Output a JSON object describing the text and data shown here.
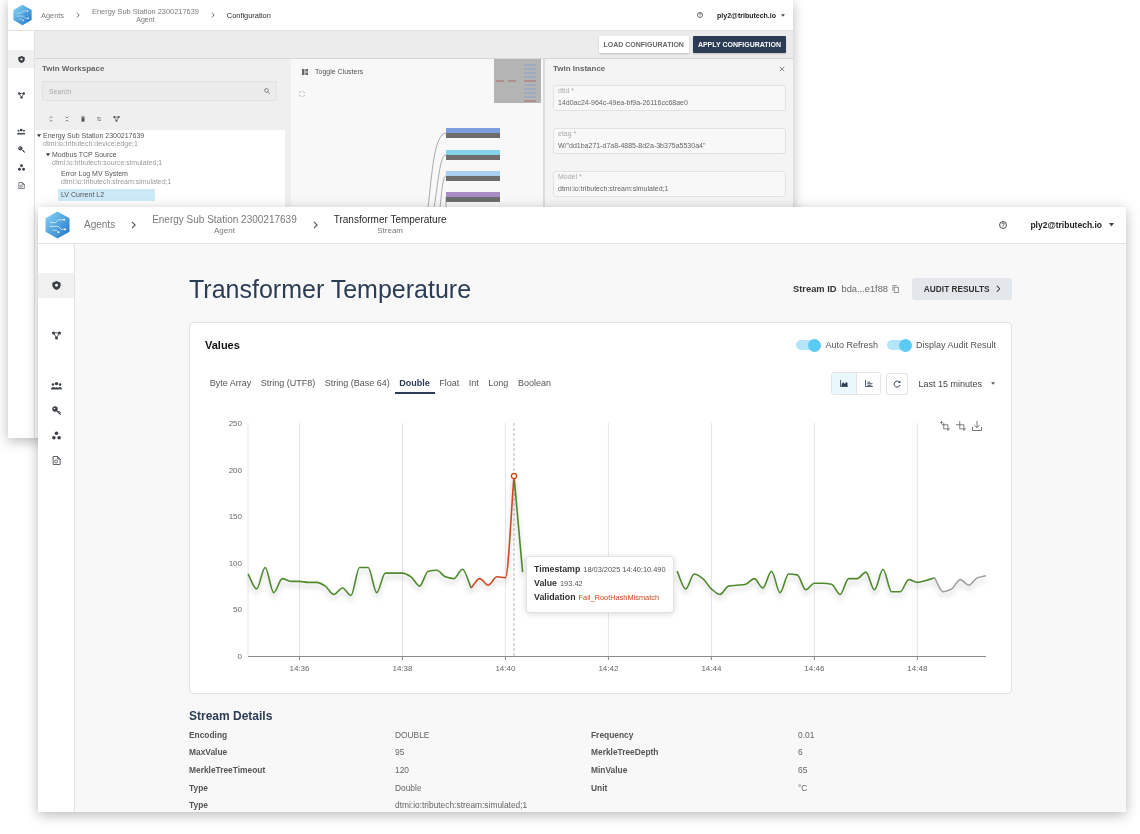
{
  "config_window": {
    "header": {
      "breadcrumbs": [
        {
          "label": "Agents"
        },
        {
          "label": "Energy Sub Station 2300217639",
          "caption": "Agent"
        },
        {
          "label": "Configuration"
        }
      ],
      "user": "ply2@tributech.io"
    },
    "sidebar": [
      {
        "selected": true
      },
      {
        "selected": false
      },
      {
        "selected": false
      },
      {
        "selected": false
      },
      {
        "selected": false
      },
      {
        "selected": false
      }
    ],
    "toolbar_buttons": [
      {
        "label": "LOAD CONFIGURATION",
        "primary": false
      },
      {
        "label": "APPLY CONFIGURATION",
        "primary": true
      }
    ],
    "workspace": {
      "title": "Twin Workspace",
      "search": {
        "placeholder": "Search"
      },
      "tree": [
        {
          "label": "Energy Sub Station 2300217639",
          "caption": "dtmi:io:tributech:device:edge;1",
          "expanded": true,
          "selected": false,
          "children": [
            {
              "label": "Modbus TCP Source",
              "caption": "dtmi:io:tributech:source:simulated;1",
              "expanded": true,
              "selected": false,
              "children": [
                {
                  "label": "Error Log MV System",
                  "caption": "dtmi:io:tributech:stream:simulated;1",
                  "selected": false
                },
                {
                  "label": "LV Current L2",
                  "selected": true
                }
              ]
            }
          ]
        }
      ]
    },
    "graph": {
      "toggle_label": "Toggle Clusters"
    },
    "instance": {
      "title": "Twin Instance",
      "fields": [
        {
          "label": "dtid *",
          "value": "14d0ac24-964c-49ea-bf9a-26116cc68ae0"
        },
        {
          "label": "etag *",
          "value": "W/\"dd1ba271-d7a8-4885-8d2a-3b375a5530a4\""
        },
        {
          "label": "Model *",
          "value": "dtmi:io:tributech:stream:simulated;1"
        }
      ]
    }
  },
  "stream_window": {
    "header": {
      "breadcrumbs": [
        {
          "label": "Agents"
        },
        {
          "label": "Energy Sub Station 2300217639",
          "caption": "Agent"
        },
        {
          "label": "Transformer Temperature",
          "caption": "Stream"
        }
      ],
      "user": "ply2@tributech.io"
    },
    "sidebar": [
      {
        "selected": true
      },
      {
        "selected": false
      },
      {
        "selected": false
      },
      {
        "selected": false
      },
      {
        "selected": false
      },
      {
        "selected": false
      }
    ],
    "title": "Transformer Temperature",
    "stream_id": {
      "label": "Stream ID",
      "value": "bda...e1f88"
    },
    "audit_button": "AUDIT RESULTS",
    "values_card": {
      "title": "Values",
      "toggles": [
        {
          "label": "Auto Refresh",
          "on": true
        },
        {
          "label": "Display Audit Result",
          "on": true
        }
      ],
      "tabs": [
        {
          "label": "Byte Array",
          "selected": false
        },
        {
          "label": "String (UTF8)",
          "selected": false
        },
        {
          "label": "String (Base 64)",
          "selected": false
        },
        {
          "label": "Double",
          "selected": true
        },
        {
          "label": "Float",
          "selected": false
        },
        {
          "label": "Int",
          "selected": false
        },
        {
          "label": "Long",
          "selected": false
        },
        {
          "label": "Boolean",
          "selected": false
        }
      ],
      "view_modes": [
        {
          "selected": true
        },
        {
          "selected": false
        }
      ],
      "time_range": "Last 15 minutes",
      "chart_data": {
        "type": "line",
        "grid": true,
        "categories": [
          null,
          null,
          null,
          null,
          null,
          null,
          "14:36",
          null,
          null,
          null,
          null,
          null,
          null,
          null,
          null,
          null,
          null,
          null,
          "14:38",
          null,
          null,
          null,
          null,
          null,
          null,
          null,
          null,
          null,
          null,
          null,
          "14:40",
          null,
          null,
          null,
          null,
          null,
          null,
          null,
          null,
          null,
          null,
          null,
          "14:42",
          null,
          null,
          null,
          null,
          null,
          null,
          null,
          null,
          null,
          null,
          null,
          "14:44",
          null,
          null,
          null,
          null,
          null,
          null,
          null,
          null,
          null,
          null,
          null,
          "14:46",
          null,
          null,
          null,
          null,
          null,
          null,
          null,
          null,
          null,
          null,
          null,
          "14:48",
          null,
          null,
          null,
          null,
          null,
          null,
          null,
          null
        ],
        "series": [
          {
            "color": "#4e8a2c",
            "values": [
              88,
              72,
              95,
              68,
              83,
              80,
              80,
              79,
              79,
              75,
              66,
              73,
              65,
              95,
              95,
              68,
              89,
              89,
              89,
              85,
              75,
              91,
              92,
              85,
              83,
              93,
              73,
              null,
              null,
              null,
              null,
              193,
              90,
              null,
              null,
              null,
              null,
              null,
              null,
              null,
              null,
              null,
              null,
              null,
              null,
              null,
              null,
              null,
              null,
              null,
              91,
              72,
              88,
              83,
              72,
              66,
              75,
              76,
              77,
              83,
              73,
              91,
              68,
              88,
              87,
              71,
              78,
              78,
              77,
              66,
              83,
              83,
              90,
              71,
              93,
              69,
              69,
              82,
              79,
              81,
              84,
              null,
              null,
              null,
              null,
              null,
              null
            ]
          },
          {
            "color": "#cc4b25",
            "values": [
              null,
              null,
              null,
              null,
              null,
              null,
              null,
              null,
              null,
              null,
              null,
              null,
              null,
              null,
              null,
              null,
              null,
              null,
              null,
              null,
              null,
              null,
              null,
              null,
              null,
              null,
              73,
              83,
              76,
              85,
              84,
              193,
              null,
              null,
              null,
              null,
              null,
              null,
              null,
              null,
              null,
              null,
              null,
              null,
              null,
              null,
              null,
              null,
              null,
              null,
              null,
              null,
              null,
              null,
              null,
              null,
              null,
              null,
              null,
              null,
              null,
              null,
              null,
              null,
              null,
              null,
              null,
              null,
              null,
              null,
              null,
              null,
              null,
              null,
              null,
              null,
              null,
              null,
              null,
              null,
              null,
              null,
              null,
              null,
              null,
              null,
              null
            ]
          },
          {
            "color": "#a0a0a0",
            "values": [
              null,
              null,
              null,
              null,
              null,
              null,
              null,
              null,
              null,
              null,
              null,
              null,
              null,
              null,
              null,
              null,
              null,
              null,
              null,
              null,
              null,
              null,
              null,
              null,
              null,
              null,
              null,
              null,
              null,
              null,
              null,
              null,
              null,
              null,
              null,
              null,
              null,
              null,
              null,
              null,
              null,
              null,
              null,
              null,
              null,
              null,
              null,
              null,
              null,
              null,
              null,
              null,
              null,
              null,
              null,
              null,
              null,
              null,
              null,
              null,
              null,
              null,
              null,
              null,
              null,
              null,
              null,
              null,
              null,
              null,
              null,
              null,
              null,
              null,
              null,
              null,
              null,
              null,
              null,
              null,
              84,
              69,
              72,
              82,
              76,
              84,
              86
            ]
          }
        ],
        "ylim": [
          0,
          250
        ],
        "yticks": [
          0,
          50,
          100,
          150,
          200,
          250
        ]
      },
      "tooltip": {
        "rows": [
          {
            "label": "Timestamp",
            "value": "18/03/2025 14:40:10.490",
            "kind": "plain"
          },
          {
            "label": "Value",
            "value": "193.42",
            "kind": "plain"
          },
          {
            "label": "Validation",
            "value": "Fail_RootHashMismatch",
            "kind": "error"
          }
        ]
      }
    },
    "details": {
      "title": "Stream Details",
      "properties": [
        {
          "label": "Encoding",
          "value": "DOUBLE"
        },
        {
          "label": "Frequency",
          "value": "0.01"
        },
        {
          "label": "MaxValue",
          "value": "95"
        },
        {
          "label": "MerkleTreeDepth",
          "value": "6"
        },
        {
          "label": "MerkleTreeTimeout",
          "value": "120"
        },
        {
          "label": "MinValue",
          "value": "65"
        },
        {
          "label": "Type",
          "value": "Double"
        },
        {
          "label": "Unit",
          "value": "°C"
        },
        {
          "label": "Type",
          "value": "dtmi:io:tributech:stream:simulated;1"
        }
      ]
    }
  }
}
